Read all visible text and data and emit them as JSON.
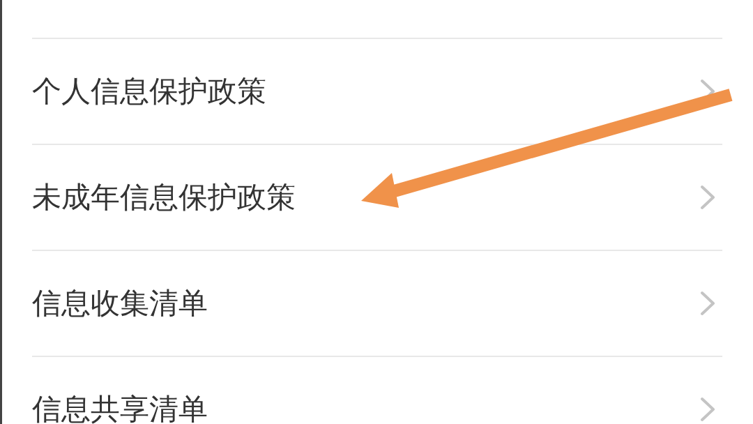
{
  "settings_list": [
    {
      "label": "个人信息保护政策"
    },
    {
      "label": "未成年信息保护政策"
    },
    {
      "label": "信息收集清单"
    },
    {
      "label": "信息共享清单"
    }
  ]
}
